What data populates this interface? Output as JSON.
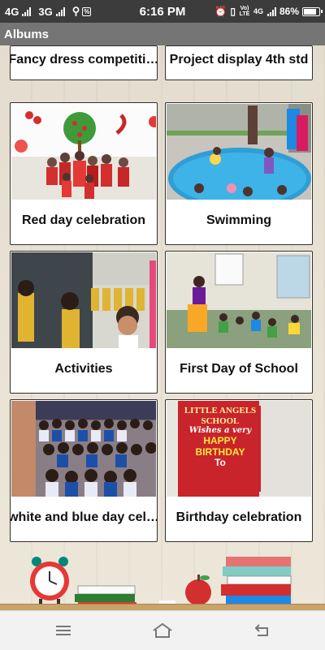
{
  "status_bar": {
    "network_1": "4G",
    "network_2": "3G",
    "time": "6:16 PM",
    "volte": "Vo) LTE",
    "network_3": "4G",
    "battery": "86%",
    "battery_level": 0.86,
    "icons": [
      "signal-icon",
      "usb-icon",
      "notification-icon",
      "alarm-icon",
      "vibrate-icon",
      "battery-icon"
    ]
  },
  "app_bar": {
    "title": "Albums"
  },
  "albums": [
    {
      "title": "Fancy dress competiti…"
    },
    {
      "title": "Project display 4th std"
    },
    {
      "title": "Red day celebration"
    },
    {
      "title": "Swimming"
    },
    {
      "title": "Activities"
    },
    {
      "title": "First Day of School"
    },
    {
      "title": "white and blue day cel…"
    },
    {
      "title": "Birthday celebration"
    }
  ],
  "photos": {
    "birthday_banner": {
      "line1": "LITTLE ANGELS",
      "line2": "SCHOOL",
      "line3": "Wishes a very",
      "line4": "HAPPY",
      "line5": "BIRTHDAY",
      "line6": "To"
    }
  },
  "nav": {
    "icons": [
      "menu-icon",
      "home-icon",
      "back-icon"
    ]
  },
  "colors": {
    "status_bar": "#3c3c3c",
    "app_bar": "#757575",
    "nav_bar": "#f2f2f2"
  }
}
